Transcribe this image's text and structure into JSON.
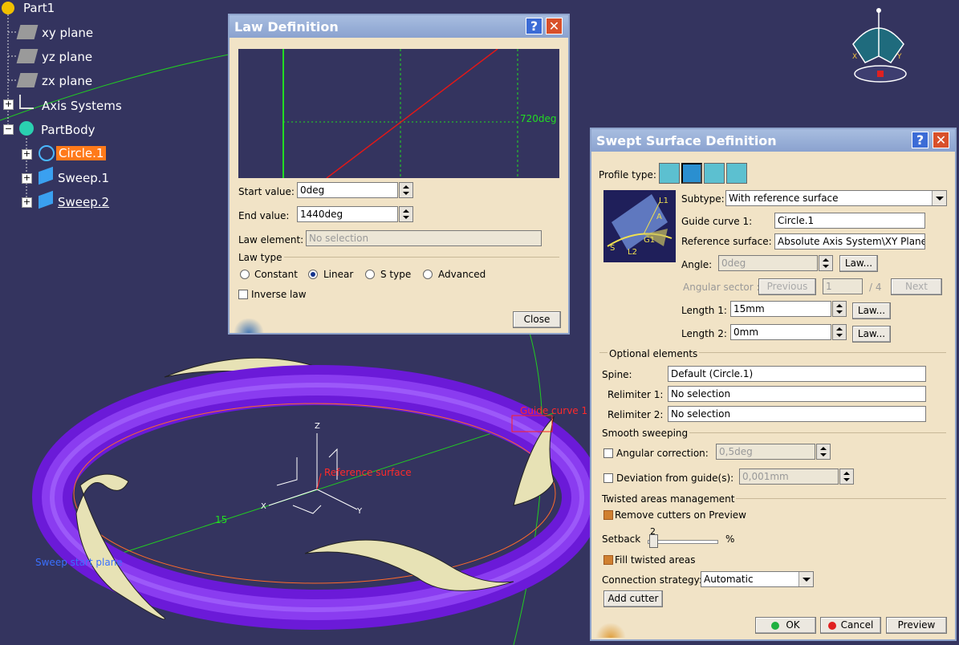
{
  "tree": {
    "root": "Part1",
    "items": [
      "xy plane",
      "yz plane",
      "zx plane",
      "Axis Systems",
      "PartBody",
      "Circle.1",
      "Sweep.1",
      "Sweep.2"
    ]
  },
  "viewport": {
    "guide_label": "Guide curve 1",
    "reference_label": "Reference surface",
    "sweep_label": "Sweep start plane",
    "value_label": "15",
    "axes": {
      "x": "X",
      "y": "Y",
      "z": "Z"
    }
  },
  "law_dialog": {
    "title": "Law Definition",
    "graph_label": "720deg",
    "start_label": "Start value:",
    "start_value": "0deg",
    "end_label": "End value:",
    "end_value": "1440deg",
    "law_element_label": "Law element:",
    "law_element_value": "No selection",
    "law_type_label": "Law type",
    "types": [
      "Constant",
      "Linear",
      "S type",
      "Advanced"
    ],
    "selected_type": "Linear",
    "inverse_label": "Inverse law",
    "close_label": "Close"
  },
  "swept_dialog": {
    "title": "Swept Surface Definition",
    "profile_type_label": "Profile type:",
    "subtype_label": "Subtype:",
    "subtype_value": "With reference surface",
    "guide_curve_label": "Guide curve 1:",
    "guide_curve_value": "Circle.1",
    "ref_surface_label": "Reference surface:",
    "ref_surface_value": "Absolute Axis System\\XY Plane",
    "angle_label": "Angle:",
    "angle_value": "0deg",
    "law_btn": "Law...",
    "angular_sector_label": "Angular sector :",
    "previous": "Previous",
    "sector_value": "1",
    "sector_total": "/ 4",
    "next": "Next",
    "length1_label": "Length 1:",
    "length1_value": "15mm",
    "length2_label": "Length 2:",
    "length2_value": "0mm",
    "optional_label": "Optional elements",
    "spine_label": "Spine:",
    "spine_value": "Default (Circle.1)",
    "relimiter1_label": "Relimiter 1:",
    "relimiter1_value": "No selection",
    "relimiter2_label": "Relimiter 2:",
    "relimiter2_value": "No selection",
    "smooth_label": "Smooth sweeping",
    "angular_correction_label": "Angular correction:",
    "angular_correction_value": "0,5deg",
    "deviation_label": "Deviation from guide(s):",
    "deviation_value": "0,001mm",
    "twisted_label": "Twisted areas management",
    "remove_cutters_label": "Remove cutters on Preview",
    "setback_label": "Setback",
    "setback_value": "2",
    "percent": "%",
    "fill_twisted_label": "Fill twisted areas",
    "connection_label": "Connection strategy:",
    "connection_value": "Automatic",
    "add_cutter": "Add cutter",
    "ok": "OK",
    "cancel": "Cancel",
    "preview": "Preview",
    "diagram_labels": {
      "l1": "L1",
      "a": "A",
      "g1": "G1",
      "s": "S",
      "l2": "L2"
    }
  }
}
